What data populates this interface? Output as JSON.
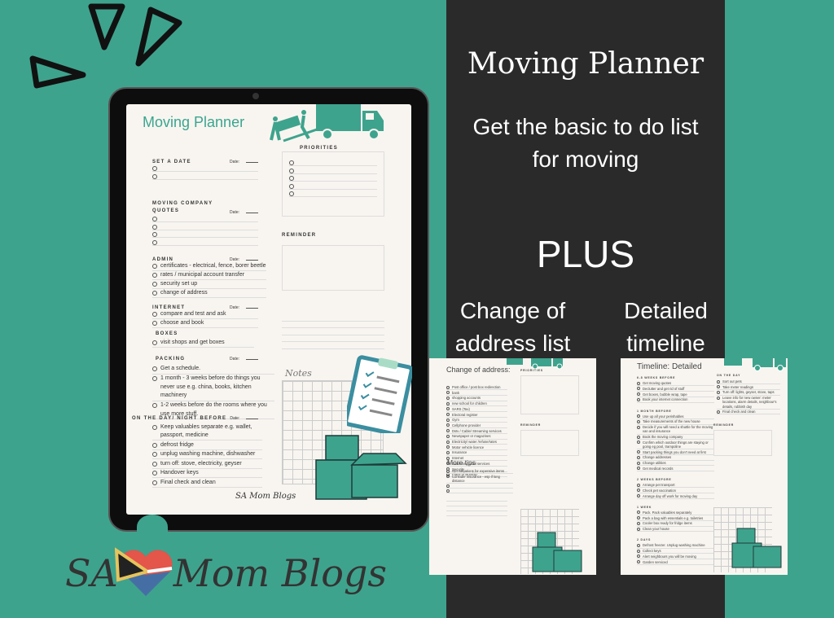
{
  "colors": {
    "teal": "#3ea38d",
    "dark_panel": "#2b2a2a",
    "cream": "#f8f5f0",
    "accent_text": "#3aa58f"
  },
  "right_panel": {
    "title": "Moving Planner",
    "subtitle_line1": "Get the basic to do list",
    "subtitle_line2": "for moving",
    "plus": "PLUS",
    "left_caption_line1": "Change of",
    "left_caption_line2": "address list",
    "right_caption_line1": "Detailed",
    "right_caption_line2": "timeline"
  },
  "planner": {
    "title": "Moving Planner",
    "date_label": "Date:",
    "sections": {
      "set_date": {
        "heading": "SET A DATE",
        "items": [
          "",
          ""
        ]
      },
      "quotes": {
        "heading": "MOVING COMPANY QUOTES",
        "items": [
          "",
          "",
          "",
          ""
        ]
      },
      "admin": {
        "heading": "ADMIN",
        "items": [
          "certificates - electrical, fence, borer beetle",
          "rates / municipal account transfer",
          "security set up",
          "change of address"
        ]
      },
      "internet": {
        "heading": "INTERNET",
        "items": [
          "compare and test and  ask",
          "choose and book"
        ]
      },
      "boxes": {
        "heading": "BOXES",
        "items": [
          "visit shops and get boxes"
        ]
      },
      "packing": {
        "heading": "PACKING",
        "items": [
          "Get a schedule.",
          "1 month - 3 weeks before do things you never use e.g. china, books, kitchen machinery",
          "1-2 weeks before do the rooms where you use more stuff."
        ]
      },
      "on_the_day": {
        "heading": "ON THE DAY/ NIGHT BEFORE",
        "items": [
          "Keep valuables separate e.g. wallet, passport, medicine",
          "defrost fridge",
          "unplug washing machine, dishwasher",
          "turn off: stove, electricity, geyser",
          "Handover keys",
          "Final check and clean"
        ]
      }
    },
    "priorities": {
      "heading": "PRIORITIES",
      "items": [
        "",
        "",
        "",
        "",
        ""
      ]
    },
    "reminder": {
      "heading": "REMINDER"
    },
    "notes": "Notes",
    "logo": "SA Mom Blogs"
  },
  "preview_change_of_address": {
    "title": "Change of address:",
    "items": [
      "Post office / post box redirection",
      "bank",
      "shopping accounts",
      "new school for children",
      "SARS (Tax)",
      "Electoral register",
      "Gym",
      "Cellphone provider",
      "Dstv / Cable/ Streaming services",
      "Newspaper or magazines",
      "Electricity/ water /refuse/rates",
      "Motor vehicle licence",
      "Insurance",
      "Internet",
      "Gardening, pool services",
      "Security",
      "Place of worship"
    ],
    "more_tips_title": "More tips",
    "tips": [
      "Get valuations for  expensive items",
      "Consider insurance - esp if long distance",
      "",
      ""
    ],
    "priorities": "PRIORITIES",
    "reminder": "REMINDER"
  },
  "preview_timeline": {
    "title": "Timeline: Detailed",
    "groups": [
      {
        "heading": "6-8 WEEKS BEFORE",
        "items": [
          "Get moving quotes",
          "Declutter and get rid of stuff",
          "Get boxes, bubble wrap, tape",
          "Book your internet connection"
        ]
      },
      {
        "heading": "1 MONTH BEFORE",
        "items": [
          "Use up all your perishables",
          "Take measurements of the new house",
          "Decide if you will need a shuttle for the moving van and insurance",
          "Book the moving company",
          "Confirm which outdoor things are staying or going eg pool, trampoline",
          "Start packing things you don't need at first",
          "Change addresses",
          "Change utilities",
          "Get medical records"
        ]
      },
      {
        "heading": "2 WEEKS BEFORE",
        "items": [
          "Arrange pet transport",
          "Check pet vaccination",
          "Arrange day off work for moving day"
        ]
      },
      {
        "heading": "1 WEEK",
        "items": [
          "Pack. Pack valuables separately",
          "Pack a bag with essentials e.g. toiletries",
          "Cooler box ready for fridge items",
          "Clean your house"
        ]
      },
      {
        "heading": "2 DAYS",
        "items": [
          "Defrost freezer. Unplug washing machine",
          "Collect keys",
          "Alert neighbours you will be moving",
          "Garden serviced"
        ]
      }
    ],
    "on_the_day": {
      "heading": "ON THE DAY",
      "items": [
        "Sort out pets",
        "Take meter readings",
        "Turn off: lights, geyser, stove, taps",
        "Leave info for new owner: meter locations, alarm details, neighbour's details, rubbish day",
        "Final check and clean"
      ]
    },
    "reminder": "REMINDER"
  },
  "brand_logo": {
    "text_left": "SA",
    "text_right": "Mom Blogs"
  }
}
